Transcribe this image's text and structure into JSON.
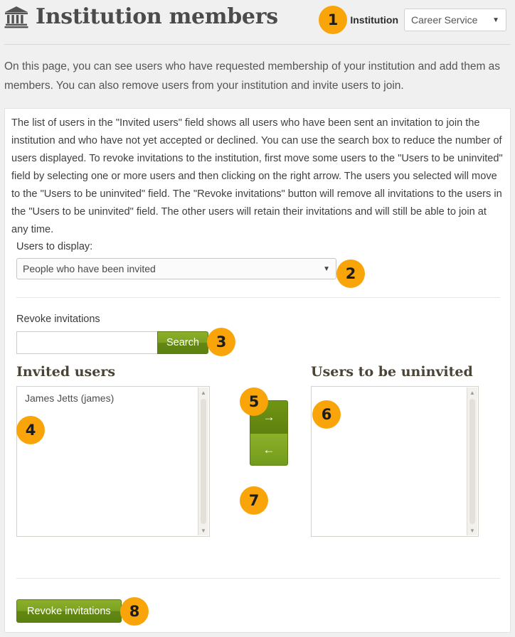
{
  "header": {
    "title": "Institution members",
    "icon": "bank-institution-icon",
    "institution_label": "Institution",
    "institution_selected": "Career Service",
    "caret": "▼"
  },
  "intro": "On this page, you can see users who have requested membership of your institution and add them as members. You can also remove users from your institution and invite users to join.",
  "panel": {
    "description": "The list of users in the \"Invited users\" field shows all users who have been sent an invitation to join the institution and who have not yet accepted or declined. You can use the search box to reduce the number of users displayed. To revoke invitations to the institution, first move some users to the \"Users to be uninvited\" field by selecting one or more users and then clicking on the right arrow. The users you selected will move to the \"Users to be uninvited\" field. The \"Revoke invitations\" button will remove all invitations to the users in the \"Users to be uninvited\" field. The other users will retain their invitations and will still be able to join at any time.",
    "users_to_display": {
      "label": "Users to display:",
      "selected": "People who have been invited",
      "caret": "▼"
    },
    "revoke_section": {
      "label": "Revoke invitations",
      "search_value": "",
      "search_placeholder": "",
      "search_button": "Search"
    },
    "invited_users": {
      "heading": "Invited users",
      "options": [
        "James Jetts (james)"
      ]
    },
    "uninvited_users": {
      "heading": "Users to be uninvited",
      "options": []
    },
    "arrows": {
      "move_right": "→",
      "move_left": "←",
      "scroll_up": "▲",
      "scroll_down": "▼"
    },
    "submit_button": "Revoke invitations"
  },
  "callouts": [
    {
      "n": "1"
    },
    {
      "n": "2"
    },
    {
      "n": "3"
    },
    {
      "n": "4"
    },
    {
      "n": "5"
    },
    {
      "n": "6"
    },
    {
      "n": "7"
    },
    {
      "n": "8"
    }
  ],
  "colors": {
    "accent_orange": "#f9a50a",
    "button_green": "#7ba122",
    "page_background": "#f0f0f0",
    "panel_background": "#ffffff"
  }
}
